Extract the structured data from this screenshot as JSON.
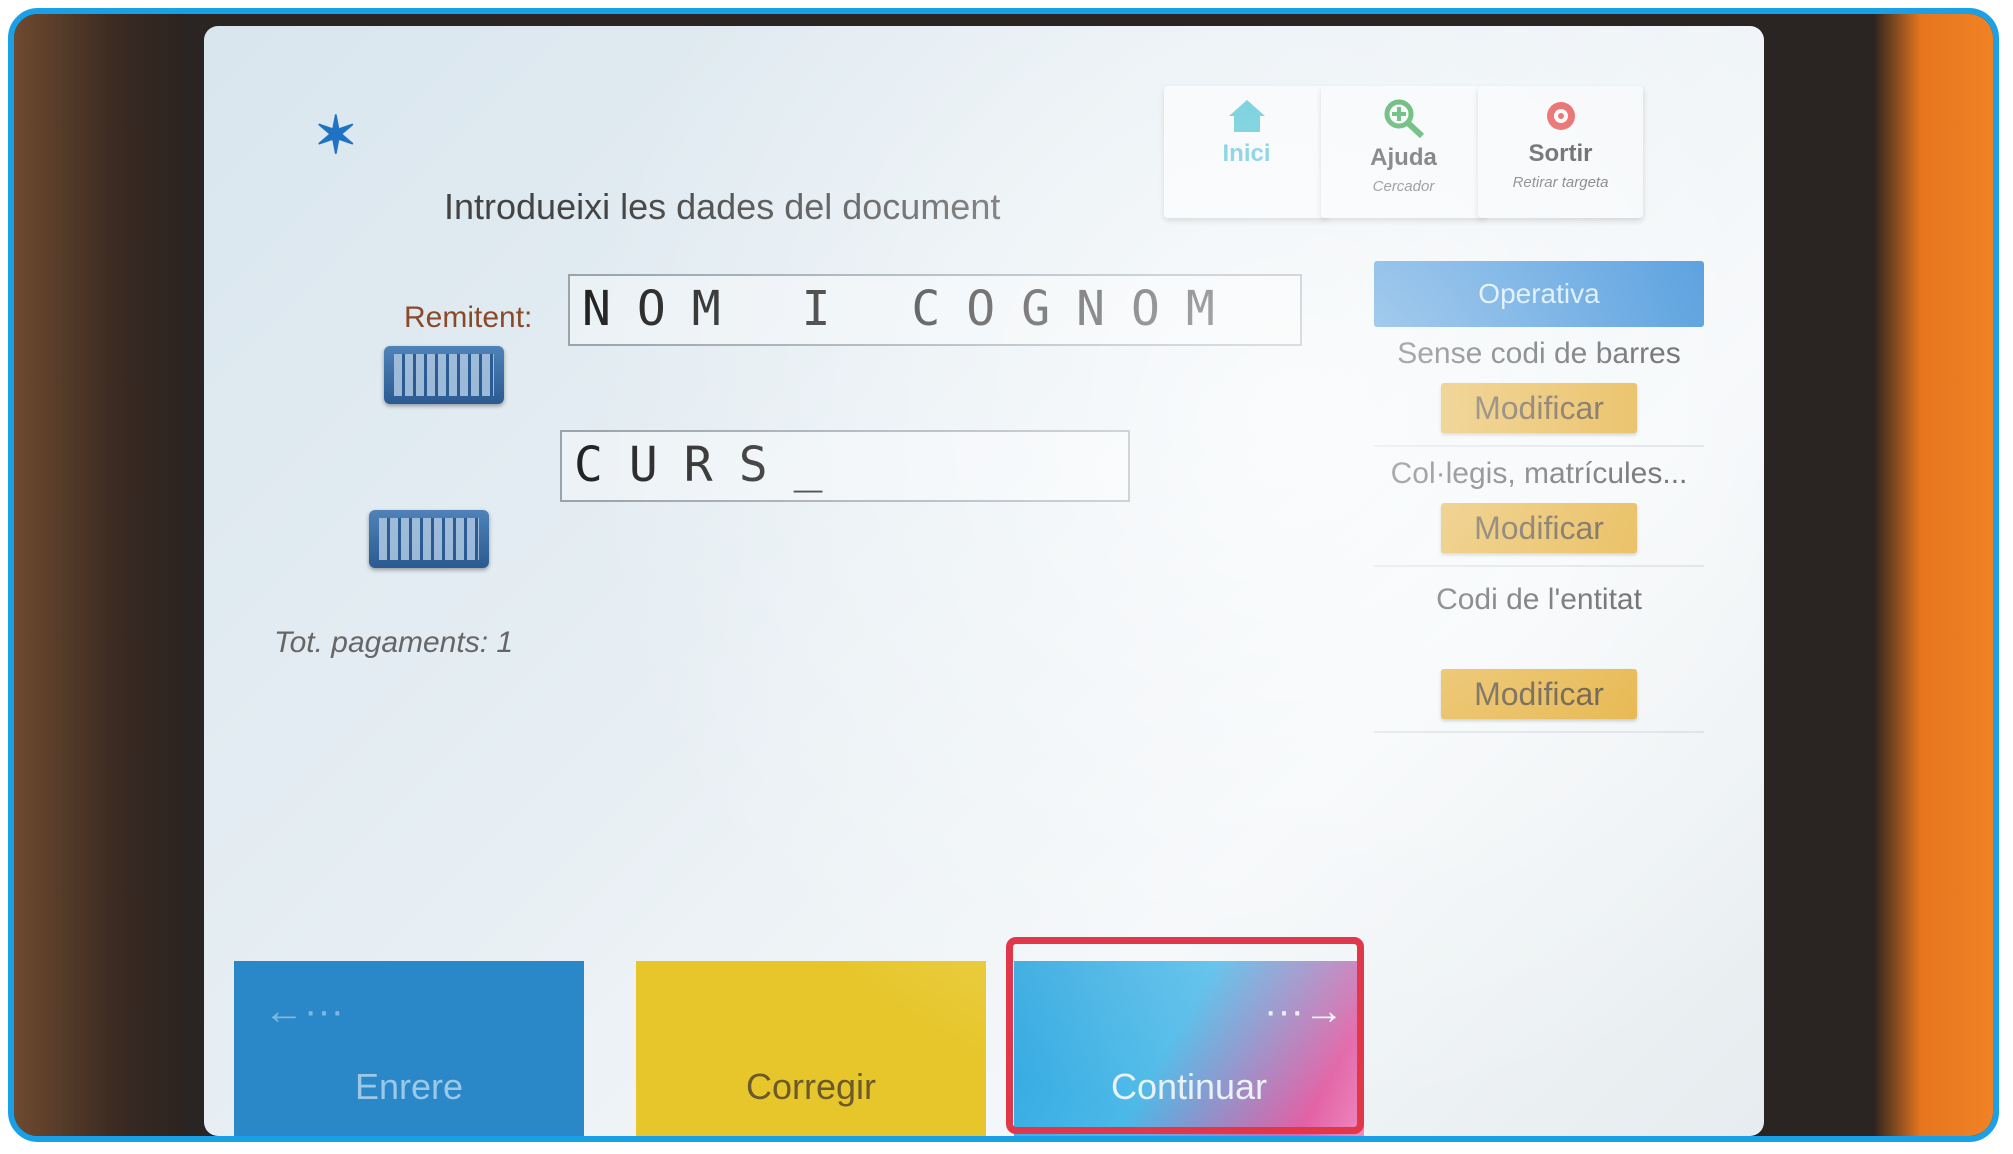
{
  "header": {
    "title": "Introdueixi les dades del document",
    "buttons": [
      {
        "label": "Inici",
        "sub": "",
        "icon": "home-icon"
      },
      {
        "label": "Ajuda",
        "sub": "Cercador",
        "icon": "search-zoom-icon"
      },
      {
        "label": "Sortir",
        "sub": "Retirar targeta",
        "icon": "exit-icon"
      }
    ]
  },
  "form": {
    "remitent_label": "Remitent:",
    "remitent_value": "NOM I COGNOM",
    "second_value": "CURS_",
    "total_label": "Tot. pagaments: 1"
  },
  "panel": {
    "header": "Operativa",
    "items": [
      {
        "text": "Sense codi de barres",
        "button": "Modificar"
      },
      {
        "text": "Col·legis, matrícules...",
        "button": "Modificar"
      },
      {
        "text": "Codi de l'entitat",
        "button": "Modificar"
      }
    ]
  },
  "footer": {
    "back": "Enrere",
    "correct": "Corregir",
    "continue": "Continuar"
  },
  "colors": {
    "highlight": "#e0374b",
    "accent_blue": "#1f7fd4",
    "modify_yellow": "#e0a21a"
  }
}
